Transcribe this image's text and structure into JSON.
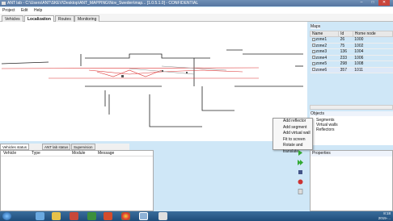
{
  "window": {
    "title": "ANT lab - C:\\Users\\ANT\\SKEV\\Desktop\\ANT_MAPPING\\Nov_Sweden\\map... [1.0.5.1.0] - CONFIDENTIAL"
  },
  "menu": [
    "Project",
    "Edit",
    "Help"
  ],
  "tabs": [
    "Vehicles",
    "Localization",
    "Routes",
    "Monitoring"
  ],
  "maps": {
    "section_label": "Maps",
    "columns": [
      "Name",
      "Id",
      "Home node"
    ],
    "rows": [
      {
        "name": "zone1",
        "id": "26",
        "home": "1000"
      },
      {
        "name": "zone2",
        "id": "75",
        "home": "1002"
      },
      {
        "name": "zone3",
        "id": "136",
        "home": "1004"
      },
      {
        "name": "zone4",
        "id": "233",
        "home": "1006"
      },
      {
        "name": "zone5",
        "id": "298",
        "home": "1008"
      },
      {
        "name": "zone6",
        "id": "357",
        "home": "1011"
      }
    ]
  },
  "objects": {
    "section_label": "Objects",
    "items": [
      "Segments",
      "Virtual walls",
      "Reflectors"
    ]
  },
  "context_menu": [
    "Add reflector",
    "Add segment",
    "Add virtual wall",
    "Fit to screen",
    "Rotate and translate..."
  ],
  "bottom_tabs": [
    "Vehicles status",
    "ANT lab status",
    "Supervision"
  ],
  "vehicle_table": {
    "columns": [
      "Vehicle",
      "Type",
      "Module",
      "Message"
    ]
  },
  "properties": {
    "section_label": "Properties"
  },
  "taskbar": {
    "time": "8:18",
    "date": "2015-..."
  },
  "colors": {
    "titlebar": "#5f80ab",
    "taskbar": "#2a5a88",
    "selection": "#dce8f8"
  }
}
